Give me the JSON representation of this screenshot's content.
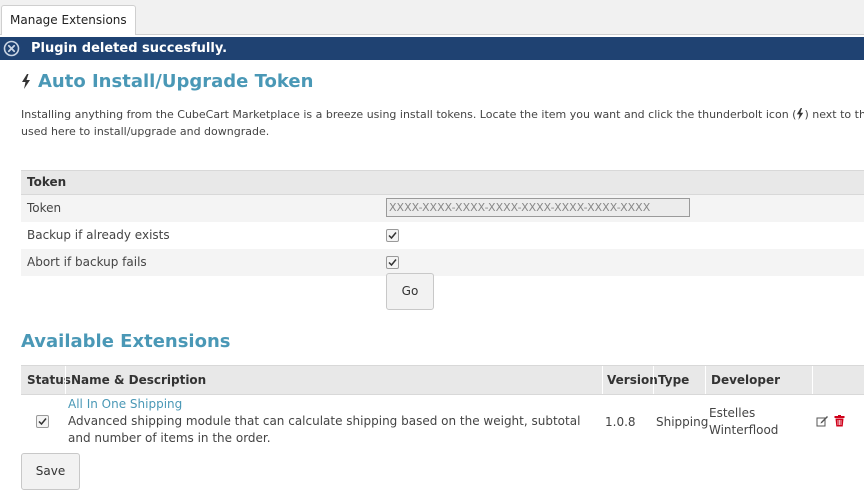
{
  "tabs": {
    "manage_extensions": "Manage Extensions"
  },
  "notice": {
    "text": "Plugin deleted succesfully.",
    "icon": "close-circle-icon",
    "color": "#1f4272"
  },
  "token_section": {
    "title": "Auto Install/Upgrade Token",
    "intro_part1": "Installing anything from the CubeCart Marketplace is a breeze using install tokens. Locate the item you want and click the thunderbolt icon (",
    "intro_part2": ") next to the",
    "intro_line2": "used here to install/upgrade and downgrade.",
    "table_header": "Token",
    "token_label": "Token",
    "token_placeholder": "XXXX-XXXX-XXXX-XXXX-XXXX-XXXX-XXXX-XXXX",
    "backup_label": "Backup if already exists",
    "backup_checked": true,
    "abort_label": "Abort if backup fails",
    "abort_checked": true,
    "go_button": "Go"
  },
  "extensions_section": {
    "title": "Available Extensions",
    "columns": {
      "status": "Status",
      "name": "Name & Description",
      "version": "Version",
      "type": "Type",
      "developer": "Developer"
    },
    "rows": [
      {
        "enabled": true,
        "name": "All In One Shipping",
        "description": "Advanced shipping module that can calculate shipping based on the weight, subtotal and number of items in the order.",
        "version": "1.0.8",
        "type": "Shipping",
        "developer": "Estelles Winterflood",
        "actions": [
          "edit-icon",
          "delete-icon"
        ]
      }
    ],
    "save_button": "Save"
  },
  "colors": {
    "accent": "#4a98b6",
    "notice": "#1f4272",
    "delete": "#d0021b"
  }
}
